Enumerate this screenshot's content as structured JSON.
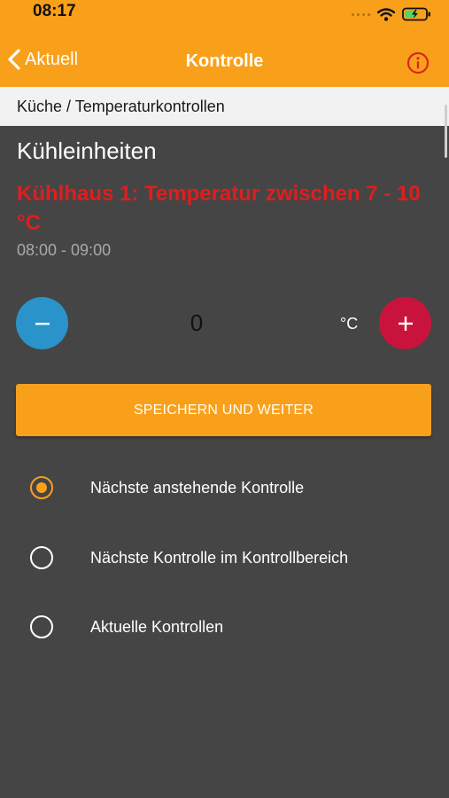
{
  "status_bar": {
    "time": "08:17"
  },
  "nav": {
    "back_label": "Aktuell",
    "title": "Kontrolle"
  },
  "breadcrumb": "Küche / Temperaturkontrollen",
  "section_heading": "Kühleinheiten",
  "alert_title": "Kühlhaus 1: Temperatur zwischen 7 - 10 °C",
  "time_range": "08:00 - 09:00",
  "stepper": {
    "value": "0",
    "unit": "°C"
  },
  "save_button": "SPEICHERN UND WEITER",
  "options": [
    {
      "label": "Nächste anstehende Kontrolle",
      "selected": true
    },
    {
      "label": "Nächste Kontrolle im Kontrollbereich",
      "selected": false
    },
    {
      "label": "Aktuelle Kontrollen",
      "selected": false
    }
  ],
  "colors": {
    "accent": "#f9a01b",
    "background": "#454545",
    "alert": "#e11d1d",
    "minus": "#2a93c9",
    "plus": "#c8143c"
  },
  "icons": {
    "back": "chevron-left-icon",
    "info": "info-icon",
    "wifi": "wifi-icon",
    "battery": "battery-charging-icon"
  }
}
